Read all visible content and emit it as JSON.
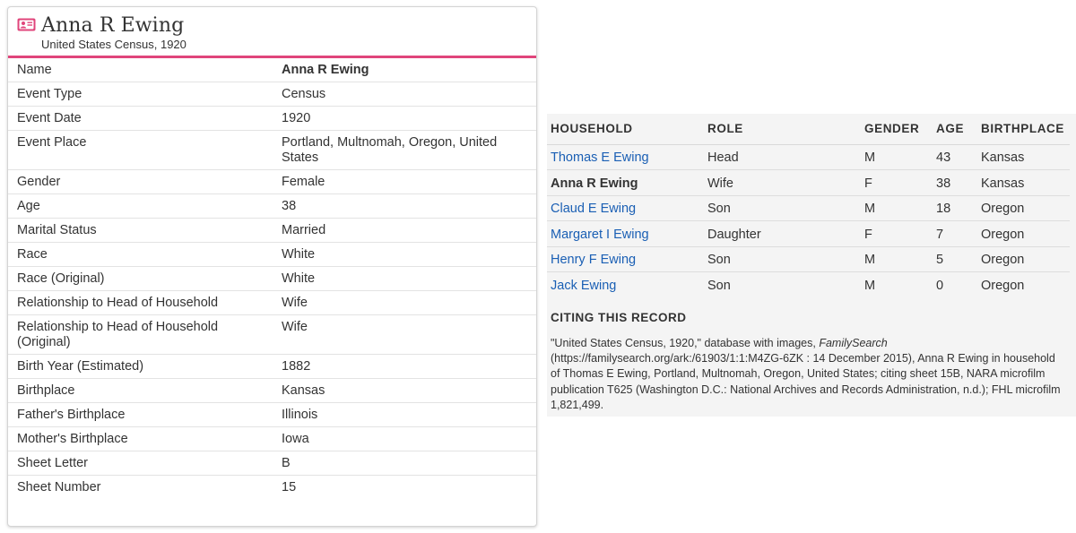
{
  "record": {
    "title": "Anna R Ewing",
    "subtitle": "United States Census, 1920",
    "icon": "person-record-icon",
    "accent_color": "#e0457b",
    "fields": [
      {
        "label": "Name",
        "value": "Anna R Ewing",
        "bold": true
      },
      {
        "label": "Event Type",
        "value": "Census"
      },
      {
        "label": "Event Date",
        "value": "1920"
      },
      {
        "label": "Event Place",
        "value": "Portland, Multnomah, Oregon, United States"
      },
      {
        "label": "Gender",
        "value": "Female"
      },
      {
        "label": "Age",
        "value": "38"
      },
      {
        "label": "Marital Status",
        "value": "Married"
      },
      {
        "label": "Race",
        "value": "White"
      },
      {
        "label": "Race (Original)",
        "value": "White"
      },
      {
        "label": "Relationship to Head of Household",
        "value": "Wife"
      },
      {
        "label": "Relationship to Head of Household (Original)",
        "value": "Wife"
      },
      {
        "label": "Birth Year (Estimated)",
        "value": "1882"
      },
      {
        "label": "Birthplace",
        "value": "Kansas"
      },
      {
        "label": "Father's Birthplace",
        "value": "Illinois"
      },
      {
        "label": "Mother's Birthplace",
        "value": "Iowa"
      },
      {
        "label": "Sheet Letter",
        "value": "B"
      },
      {
        "label": "Sheet Number",
        "value": "15"
      }
    ]
  },
  "household": {
    "headers": {
      "household": "HOUSEHOLD",
      "role": "ROLE",
      "gender": "GENDER",
      "age": "AGE",
      "birthplace": "BIRTHPLACE"
    },
    "link_color": "#1a5fb4",
    "members": [
      {
        "name": "Thomas E Ewing",
        "role": "Head",
        "gender": "M",
        "age": "43",
        "birthplace": "Kansas",
        "link": true
      },
      {
        "name": "Anna R Ewing",
        "role": "Wife",
        "gender": "F",
        "age": "38",
        "birthplace": "Kansas",
        "link": false
      },
      {
        "name": "Claud E Ewing",
        "role": "Son",
        "gender": "M",
        "age": "18",
        "birthplace": "Oregon",
        "link": true
      },
      {
        "name": "Margaret I Ewing",
        "role": "Daughter",
        "gender": "F",
        "age": "7",
        "birthplace": "Oregon",
        "link": true
      },
      {
        "name": "Henry F Ewing",
        "role": "Son",
        "gender": "M",
        "age": "5",
        "birthplace": "Oregon",
        "link": true
      },
      {
        "name": "Jack Ewing",
        "role": "Son",
        "gender": "M",
        "age": "0",
        "birthplace": "Oregon",
        "link": true
      }
    ]
  },
  "citing": {
    "heading": "CITING THIS RECORD",
    "prefix": "\"United States Census, 1920,\" database with images, ",
    "source": "FamilySearch",
    "suffix": " (https://familysearch.org/ark:/61903/1:1:M4ZG-6ZK : 14 December 2015), Anna R Ewing in household of Thomas E Ewing, Portland, Multnomah, Oregon, United States; citing sheet 15B, NARA microfilm publication T625 (Washington D.C.: National Archives and Records Administration, n.d.); FHL microfilm 1,821,499."
  }
}
